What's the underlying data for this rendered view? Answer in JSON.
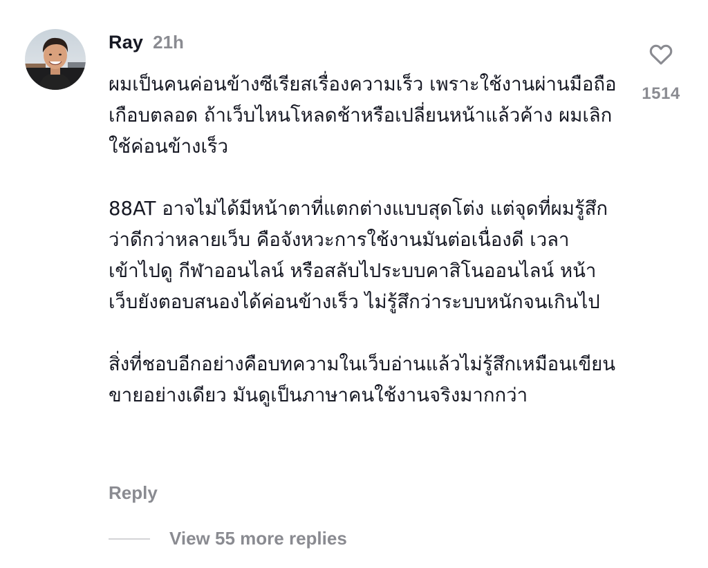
{
  "comment": {
    "username": "Ray",
    "time": "21h",
    "paragraphs": [
      "ผมเป็นคนค่อนข้างซีเรียสเรื่องความเร็ว เพราะใช้งานผ่านมือถือเกือบตลอด ถ้าเว็บไหนโหลดช้าหรือเปลี่ยนหน้าแล้วค้าง ผมเลิกใช้ค่อนข้างเร็ว",
      "88AT อาจไม่ได้มีหน้าตาที่แตกต่างแบบสุดโต่ง แต่จุดที่ผมรู้สึกว่าดีกว่าหลายเว็บ คือจังหวะการใช้งานมันต่อเนื่องดี เวลาเข้าไปดู กีฬาออนไลน์ หรือสลับไประบบคาสิโนออนไลน์ หน้าเว็บยังตอบสนองได้ค่อนข้างเร็ว ไม่รู้สึกว่าระบบหนักจนเกินไป",
      "สิ่งที่ชอบอีกอย่างคือบทความในเว็บอ่านแล้วไม่รู้สึกเหมือนเขียนขายอย่างเดียว มันดูเป็นภาษาคนใช้งานจริงมากกว่า"
    ],
    "like_count": "1514",
    "reply_label": "Reply",
    "view_more_label": "View 55 more replies"
  },
  "icons": {
    "like": "heart-outline-icon",
    "avatar": "user-avatar"
  },
  "colors": {
    "text": "#161823",
    "muted": "#8a8b91",
    "divider": "#d3d3d6"
  }
}
